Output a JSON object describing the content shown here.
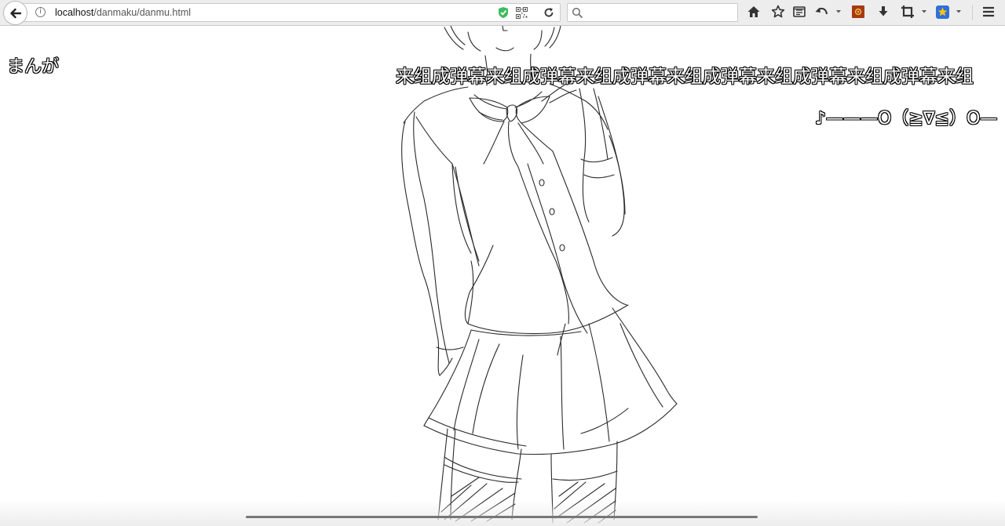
{
  "browser": {
    "url_host": "localhost",
    "url_path": "/danmaku/danmu.html",
    "search": {
      "placeholder": ""
    },
    "icons": {
      "back": "back-arrow-icon",
      "info": "info-icon",
      "tracking_protection": "shield-icon",
      "qr_code": "qr-code-icon",
      "reload": "reload-icon",
      "search": "search-icon",
      "home": "home-icon",
      "bookmark": "star-icon",
      "reader": "reader-view-icon",
      "history_back": "undo-arrow-icon",
      "addon": "addon-icon",
      "download": "download-icon",
      "crop": "crop-icon",
      "favorites": "favorites-icon",
      "menu": "hamburger-menu-icon"
    }
  },
  "danmu": [
    {
      "text": "まんが"
    },
    {
      "text": "来组成弹幕来组成弹幕来组成弹幕来组成弹幕来组成弹幕来组成弹幕来组"
    },
    {
      "text": "♪———O（≧∇≦）O—"
    }
  ],
  "colors": {
    "danmu_fill": "#ffffff",
    "danmu_outline": "#000000",
    "toolbar_bg": "#ededed",
    "addon_icon": "#a63a12",
    "favorites_icon": "#2f6fd8"
  }
}
